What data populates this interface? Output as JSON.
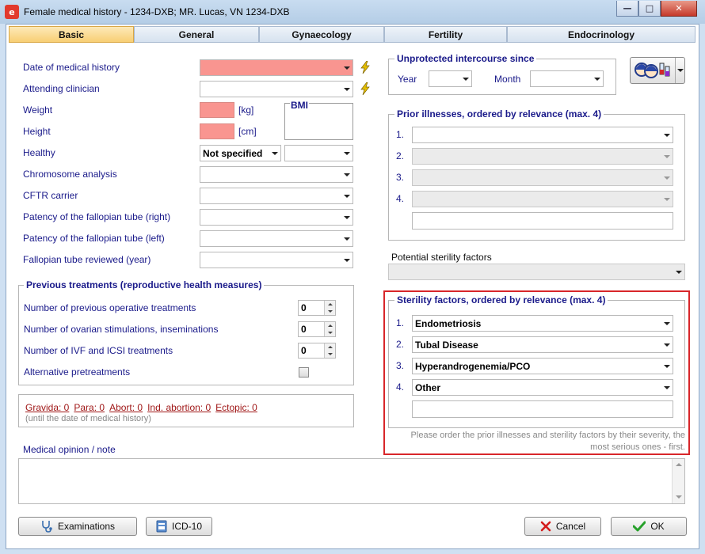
{
  "window": {
    "title": "Female medical history - 1234-DXB; MR. Lucas, VN 1234-DXB",
    "app_icon": "e"
  },
  "tabs": [
    "Basic",
    "General",
    "Gynaecology",
    "Fertility",
    "Endocrinology"
  ],
  "left": {
    "date_label": "Date of medical history",
    "clinician_label": "Attending clinician",
    "weight_label": "Weight",
    "weight_unit": "[kg]",
    "height_label": "Height",
    "height_unit": "[cm]",
    "bmi_label": "BMI",
    "healthy_label": "Healthy",
    "healthy_value": "Not specified",
    "chromosome_label": "Chromosome analysis",
    "cftr_label": "CFTR carrier",
    "patency_right_label": "Patency of the fallopian tube (right)",
    "patency_left_label": "Patency of the fallopian tube (left)",
    "fallopian_reviewed_label": "Fallopian tube reviewed (year)"
  },
  "previous_treatments": {
    "title": "Previous treatments (reproductive health measures)",
    "operative_label": "Number of previous operative treatments",
    "operative_value": "0",
    "ovarian_label": "Number of ovarian stimulations, inseminations",
    "ovarian_value": "0",
    "ivf_label": "Number of IVF and ICSI treatments",
    "ivf_value": "0",
    "alternative_label": "Alternative pretreatments"
  },
  "obstetric": {
    "gravida": "Gravida: 0",
    "para": "Para: 0",
    "abort": "Abort: 0",
    "ind_abortion": "Ind. abortion: 0",
    "ectopic": "Ectopic: 0",
    "note": "(until the date of medical history)"
  },
  "medical_opinion_label": "Medical opinion / note",
  "unprotected": {
    "title": "Unprotected intercourse since",
    "year_label": "Year",
    "month_label": "Month"
  },
  "prior_illnesses": {
    "title": "Prior illnesses, ordered by relevance (max. 4)",
    "numbers": [
      "1.",
      "2.",
      "3.",
      "4."
    ]
  },
  "potential_sterility_label": "Potential sterility factors",
  "sterility_factors": {
    "title": "Sterility factors, ordered by relevance (max. 4)",
    "items": [
      {
        "num": "1.",
        "value": "Endometriosis"
      },
      {
        "num": "2.",
        "value": "Tubal Disease"
      },
      {
        "num": "3.",
        "value": "Hyperandrogenemia/PCO"
      },
      {
        "num": "4.",
        "value": "Other"
      }
    ],
    "hint_line1": "Please order the prior illnesses and sterility factors by their severity, the",
    "hint_line2": "most serious ones - first."
  },
  "buttons": {
    "examinations": "Examinations",
    "icd10": "ICD-10",
    "cancel": "Cancel",
    "ok": "OK"
  },
  "colors": {
    "required_field": "#f99590",
    "highlight_border": "#d8262a",
    "active_tab": "#f8cf74",
    "label_text": "#1a1a8a",
    "link_text": "#a01818"
  }
}
